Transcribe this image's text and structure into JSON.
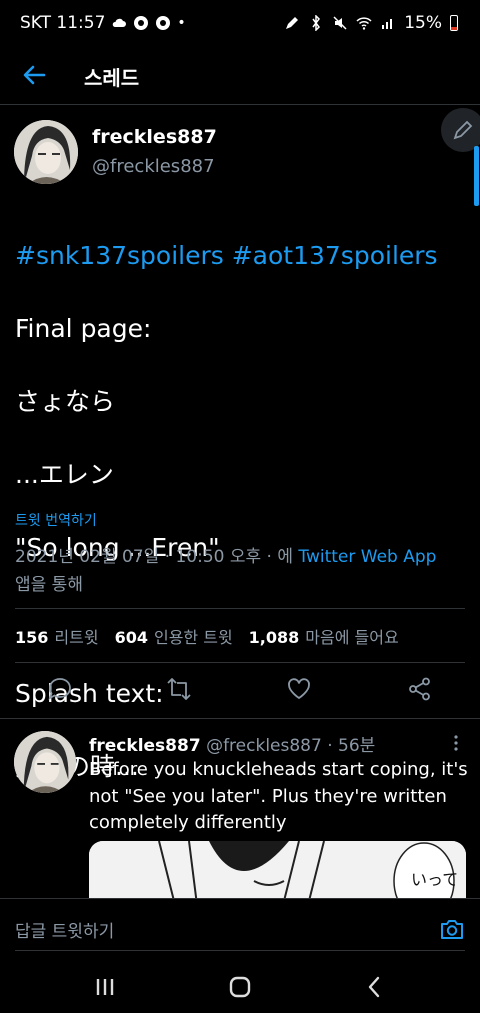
{
  "status_bar": {
    "carrier_time": "SKT 11:57",
    "battery": "15%"
  },
  "header": {
    "title": "스레드"
  },
  "tweet": {
    "name": "freckles887",
    "handle": "@freckles887",
    "hashtags": "#snk137spoilers #aot137spoilers",
    "line1": "Final page:",
    "line2": "さょなら",
    "line3": "...エレン",
    "line4": "\"So long ...Eren\"",
    "line5": "Splash text:",
    "line6": "覚悟の時...",
    "translate": "트윗 번역하기",
    "datetime": "2021년 02월 07일 · 10:50 오후 · 에",
    "app": "Twitter Web App",
    "via": "앱을 통해",
    "retweets_count": "156",
    "retweets_label": "리트윗",
    "quotes_count": "604",
    "quotes_label": "인용한 트윗",
    "likes_count": "1,088",
    "likes_label": "마음에 들어요"
  },
  "reply": {
    "name": "freckles887",
    "handle_time": "@freckles887 · 56분",
    "text": "Before you knuckleheads start coping, it's not \"See you later\". Plus they're written completely differently",
    "image_text": "いって"
  },
  "reply_bar": {
    "placeholder": "답글 트윗하기"
  },
  "colors": {
    "accent": "#1d9bf0",
    "muted": "#8b98a5",
    "divider": "#2f3336"
  },
  "icons": [
    "back-arrow-icon",
    "compose-icon",
    "reply-icon",
    "retweet-icon",
    "like-icon",
    "share-icon",
    "more-icon",
    "camera-icon",
    "recents-icon",
    "home-icon",
    "back-nav-icon"
  ]
}
